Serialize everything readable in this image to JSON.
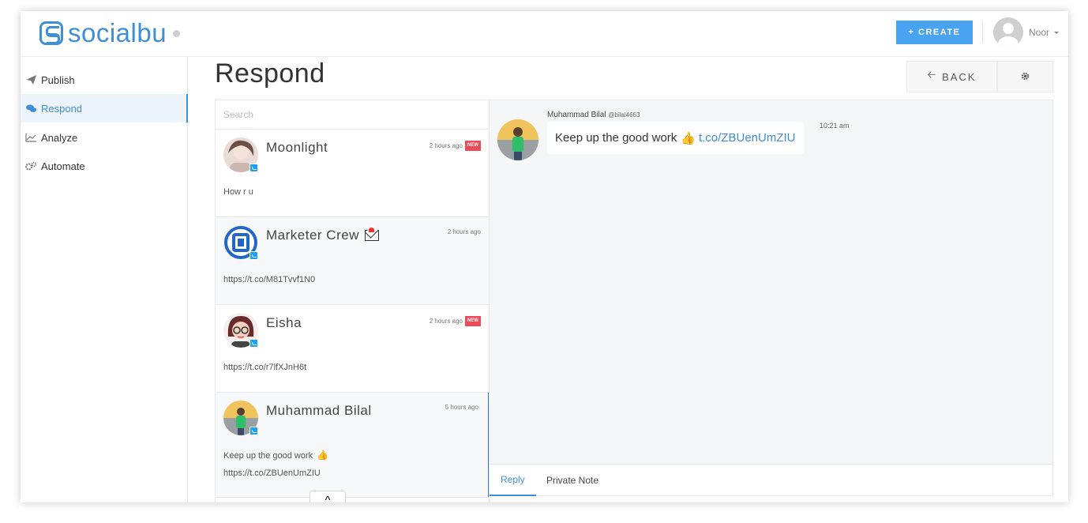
{
  "brand": {
    "name": "socialbu",
    "accent": "#3f8ed8"
  },
  "header": {
    "create_label": "+ CREATE",
    "user_name": "Noor"
  },
  "sidebar": {
    "items": [
      {
        "label": "Publish",
        "icon": "paper-plane-icon"
      },
      {
        "label": "Respond",
        "icon": "chat-bubbles-icon",
        "active": true
      },
      {
        "label": "Analyze",
        "icon": "line-chart-icon"
      },
      {
        "label": "Automate",
        "icon": "gears-icon"
      }
    ]
  },
  "main": {
    "title": "Respond",
    "back_label": "BACK",
    "search_placeholder": "Search"
  },
  "conversations": [
    {
      "name": "Moonlight",
      "time": "2 hours ago",
      "badge": "NEW",
      "preview": "How r u",
      "network": "twitter"
    },
    {
      "name": "Marketer Crew",
      "time": "2 hours ago",
      "badge": "",
      "preview": "https://t.co/M81Tvvf1N0",
      "network": "twitter",
      "emoji": "envelope-with-heart-icon"
    },
    {
      "name": "Eisha",
      "time": "2 hours ago",
      "badge": "NEW",
      "preview": "https://t.co/r7lfXJnH6t",
      "network": "twitter"
    },
    {
      "name": "Muhammad Bilal",
      "time": "5 hours ago",
      "badge": "",
      "preview_line1": "Keep up the good work",
      "preview_line2": "https://t.co/ZBUenUmZIU",
      "network": "twitter",
      "selected": true
    }
  ],
  "thread": {
    "author": "Muhammad Bilal",
    "handle": "@bilal4663",
    "message_text": "Keep up the good work",
    "message_link": "t.co/ZBUenUmZIU",
    "time": "10:21 am"
  },
  "reply_tabs": [
    {
      "label": "Reply",
      "active": true
    },
    {
      "label": "Private Note",
      "active": false
    }
  ]
}
